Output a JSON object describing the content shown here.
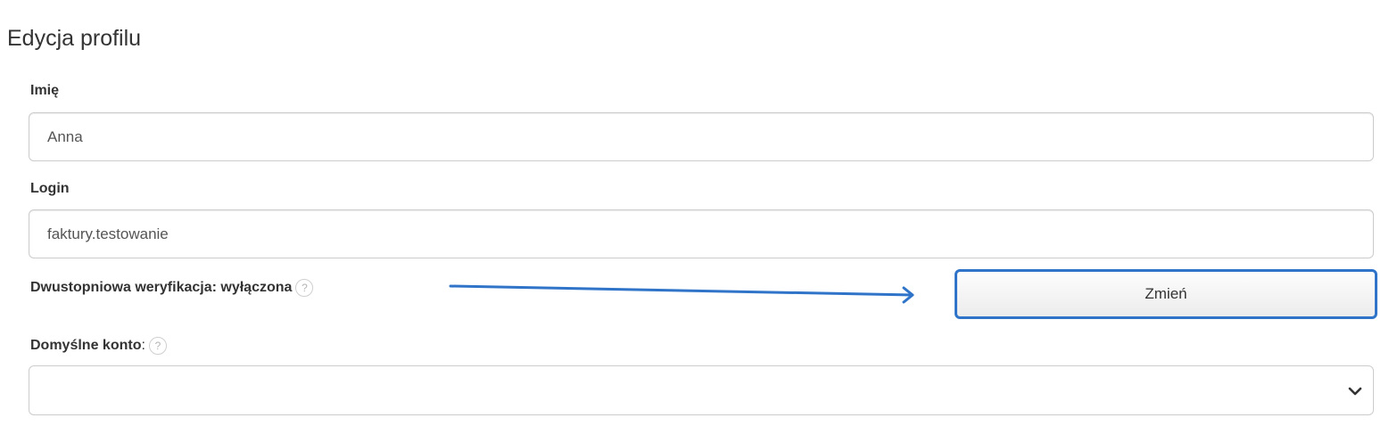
{
  "page_title": "Edycja profilu",
  "fields": {
    "first_name": {
      "label": "Imię",
      "value": "Anna"
    },
    "login": {
      "label": "Login",
      "value": "faktury.testowanie"
    },
    "two_factor": {
      "label": "Dwustopniowa weryfikacja: wyłączona",
      "help_icon": "?",
      "button_label": "Zmień"
    },
    "default_account": {
      "label": "Domyślne konto",
      "colon": ":",
      "help_icon": "?",
      "selected_value": ""
    }
  },
  "colors": {
    "highlight_border": "#2f74c9",
    "annotation_arrow": "#2f74c9"
  },
  "icons": {
    "help": "question-circle-icon",
    "annotation": "arrow-right-icon",
    "select": "chevron-down-icon"
  }
}
